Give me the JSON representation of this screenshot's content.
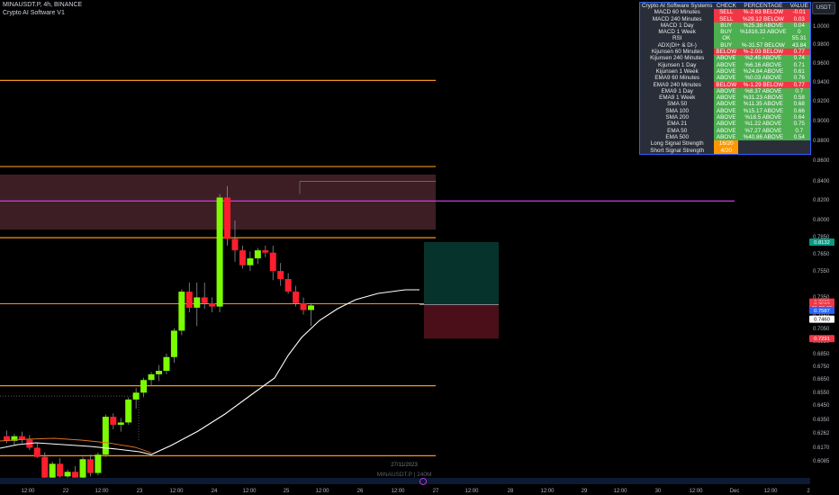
{
  "header": {
    "symbol_line": "MINAUSDT.P, 4h, BINANCE",
    "indicator_line": "Crypto AI Software V1"
  },
  "currency_button": "USDT",
  "watermark": "MINAUSDT.P | 240M",
  "date_tooltip": "27/11/2023",
  "table": {
    "headers": [
      "Crypto AI Software Systems",
      "CHECK",
      "PERCENTAGE",
      "VALUE"
    ],
    "rows": [
      [
        "MACD 60 Minutes",
        "SELL",
        "%-2.63 BELOW",
        "-0.01"
      ],
      [
        "MACD 240 Minutes",
        "SELL",
        "%29.12 BELOW",
        "0.03"
      ],
      [
        "MACD 1 Day",
        "BUY",
        "%25.38 ABOVE",
        "0.04"
      ],
      [
        "MACD 1 Week",
        "BUY",
        "%1816.33 ABOVE",
        "0"
      ],
      [
        "RSI",
        "OK",
        "-",
        "55.31"
      ],
      [
        "ADX(DI+ & DI-)",
        "BUY",
        "%-31.57 BELOW",
        "43.84"
      ],
      [
        "Kijunsen 60 Minutes",
        "BELOW",
        "%-2.03 BELOW",
        "0.77"
      ],
      [
        "Kijunsen 240 Minutes",
        "ABOVE",
        "%2.45 ABOVE",
        "0.74"
      ],
      [
        "Kijunsen 1 Day",
        "ABOVE",
        "%6.16 ABOVE",
        "0.71"
      ],
      [
        "Kijunsen 1 Week",
        "ABOVE",
        "%24.84 ABOVE",
        "0.61"
      ],
      [
        "EMA9 60 Minutes",
        "ABOVE",
        "%0.03 ABOVE",
        "0.76"
      ],
      [
        "EMA9 240 Minutes",
        "BELOW",
        "%-1.29 BELOW",
        "0.77"
      ],
      [
        "EMA9 1 Day",
        "ABOVE",
        "%8.37 ABOVE",
        "0.7"
      ],
      [
        "EMA9 1 Week",
        "ABOVE",
        "%31.23 ABOVE",
        "0.58"
      ],
      [
        "SMA 50",
        "ABOVE",
        "%11.35 ABOVE",
        "0.68"
      ],
      [
        "SMA 100",
        "ABOVE",
        "%15.17 ABOVE",
        "0.66"
      ],
      [
        "SMA 200",
        "ABOVE",
        "%18.5 ABOVE",
        "0.64"
      ],
      [
        "EMA 21",
        "ABOVE",
        "%1.22 ABOVE",
        "0.75"
      ],
      [
        "EMA 50",
        "ABOVE",
        "%7.27 ABOVE",
        "0.7"
      ],
      [
        "EMA 500",
        "ABOVE",
        "%40.86 ABOVE",
        "0.54"
      ]
    ],
    "signals": [
      [
        "Long Signal Strength",
        "16/20"
      ],
      [
        "Short Signal Strength",
        "4/20"
      ]
    ]
  },
  "colors": {
    "bull": "#7cfc00",
    "bear": "#ff1e2d",
    "level": "#f7931a",
    "magenta": "#e040fb",
    "sell": "#f23645",
    "buy": "#4caf50",
    "signal": "#ff9800",
    "zone": "#3d1e24",
    "tp": "#06332c",
    "sl": "#4a0f18"
  },
  "chart_data": {
    "type": "candlestick",
    "timeframe": "4h",
    "ylim": [
      0.6085,
      1.01
    ],
    "y_ticks": [
      "1.0000",
      "0.9800",
      "0.9600",
      "0.9400",
      "0.9200",
      "0.9000",
      "0.8800",
      "0.8600",
      "0.8400",
      "0.8200",
      "0.8000",
      "0.7850",
      "0.7650",
      "0.7550",
      "0.7350",
      "0.7150",
      "0.7050",
      "0.6950",
      "0.6850",
      "0.6750",
      "0.6650",
      "0.6550",
      "0.6450",
      "0.6350",
      "0.6262",
      "0.6170",
      "0.6085"
    ],
    "x_labels": [
      "12:00",
      "22",
      "12:00",
      "23",
      "12:00",
      "24",
      "12:00",
      "25",
      "12:00",
      "26",
      "12:00",
      "27",
      "12:00",
      "28",
      "12:00",
      "29",
      "12:00",
      "30",
      "12:00",
      "Dec",
      "12:00",
      "2"
    ],
    "candles": [
      [
        0.644,
        0.649,
        0.638,
        0.64
      ],
      [
        0.64,
        0.646,
        0.636,
        0.644
      ],
      [
        0.644,
        0.648,
        0.638,
        0.641
      ],
      [
        0.641,
        0.645,
        0.632,
        0.634
      ],
      [
        0.634,
        0.638,
        0.625,
        0.626
      ],
      [
        0.626,
        0.63,
        0.604,
        0.608
      ],
      [
        0.608,
        0.622,
        0.604,
        0.62
      ],
      [
        0.62,
        0.625,
        0.608,
        0.609
      ],
      [
        0.609,
        0.615,
        0.604,
        0.613
      ],
      [
        0.613,
        0.618,
        0.606,
        0.608
      ],
      [
        0.608,
        0.626,
        0.606,
        0.624
      ],
      [
        0.624,
        0.628,
        0.609,
        0.612
      ],
      [
        0.612,
        0.63,
        0.61,
        0.628
      ],
      [
        0.628,
        0.663,
        0.626,
        0.661
      ],
      [
        0.661,
        0.664,
        0.65,
        0.654
      ],
      [
        0.654,
        0.66,
        0.648,
        0.656
      ],
      [
        0.656,
        0.678,
        0.654,
        0.676
      ],
      [
        0.676,
        0.686,
        0.668,
        0.682
      ],
      [
        0.682,
        0.695,
        0.678,
        0.693
      ],
      [
        0.693,
        0.7,
        0.688,
        0.698
      ],
      [
        0.698,
        0.706,
        0.692,
        0.701
      ],
      [
        0.701,
        0.716,
        0.698,
        0.713
      ],
      [
        0.713,
        0.738,
        0.708,
        0.736
      ],
      [
        0.736,
        0.772,
        0.732,
        0.77
      ],
      [
        0.77,
        0.778,
        0.752,
        0.756
      ],
      [
        0.756,
        0.778,
        0.74,
        0.765
      ],
      [
        0.765,
        0.778,
        0.755,
        0.76
      ],
      [
        0.76,
        0.765,
        0.752,
        0.757
      ],
      [
        0.757,
        0.855,
        0.752,
        0.852
      ],
      [
        0.852,
        0.862,
        0.81,
        0.816
      ],
      [
        0.816,
        0.832,
        0.796,
        0.806
      ],
      [
        0.806,
        0.81,
        0.79,
        0.793
      ],
      [
        0.793,
        0.805,
        0.788,
        0.799
      ],
      [
        0.799,
        0.808,
        0.794,
        0.806
      ],
      [
        0.806,
        0.81,
        0.8,
        0.804
      ],
      [
        0.804,
        0.81,
        0.78,
        0.788
      ],
      [
        0.788,
        0.795,
        0.775,
        0.781
      ],
      [
        0.781,
        0.786,
        0.768,
        0.77
      ],
      [
        0.77,
        0.775,
        0.757,
        0.76
      ],
      [
        0.76,
        0.765,
        0.75,
        0.754
      ],
      [
        0.754,
        0.76,
        0.74,
        0.758
      ]
    ],
    "horizontal_levels": [
      0.954,
      0.879,
      0.817,
      0.688,
      0.627
    ],
    "zone": [
      0.824,
      0.872
    ],
    "magenta_level": 0.849,
    "position": {
      "entry": 0.7587,
      "target": 0.8132,
      "stop": 0.7291
    },
    "price_labels": [
      {
        "text": "0.8132",
        "price": 0.8132,
        "color": "#089981"
      },
      {
        "text": "0.7609",
        "price": 0.7609,
        "color": "#f23645"
      },
      {
        "text": "0.7587",
        "price": 0.7587,
        "color": "#f23645"
      },
      {
        "text": "01:22:00",
        "price": 0.756,
        "color": "#f23645"
      },
      {
        "text": "0.7587",
        "price": 0.7537,
        "color": "#2962ff"
      },
      {
        "text": "0.7460",
        "price": 0.746,
        "color": "#ffffff"
      },
      {
        "text": "0.7291",
        "price": 0.7291,
        "color": "#f23645"
      }
    ]
  }
}
